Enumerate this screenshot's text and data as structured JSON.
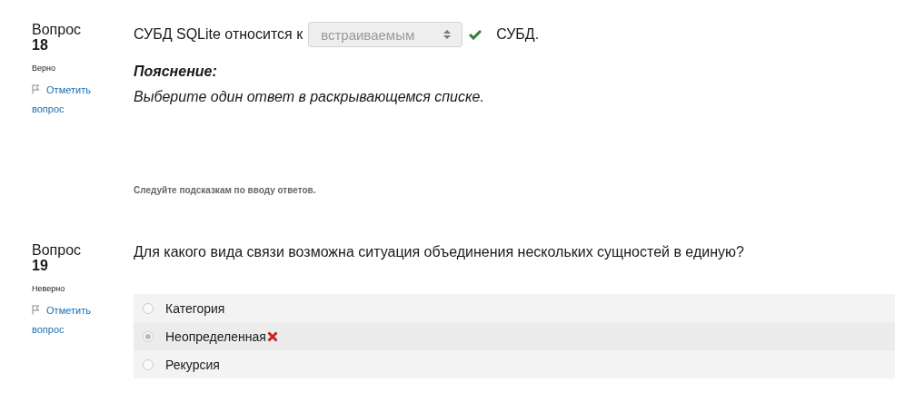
{
  "questions": [
    {
      "kind": "select",
      "label": "Вопрос",
      "number": "18",
      "status": "Верно",
      "flag_link": "Отметить вопрос",
      "text_before": "СУБД SQLite относится к",
      "select": {
        "value": "встраиваемым",
        "disabled": true,
        "correct": true
      },
      "text_after": "СУБД.",
      "explanation_title": "Пояснение:",
      "explanation": "Выберите один ответ в раскрывающемся списке.",
      "hint": "Следуйте подсказкам по вводу ответов."
    },
    {
      "kind": "choice",
      "label": "Вопрос",
      "number": "19",
      "status": "Неверно",
      "flag_link": "Отметить вопрос",
      "text": "Для какого вида связи возможна ситуация объединения нескольких сущностей в единую?",
      "options": [
        {
          "label": "Категория",
          "selected": false,
          "wrong": false
        },
        {
          "label": "Неопределенная",
          "selected": true,
          "wrong": true
        },
        {
          "label": "Рекурсия",
          "selected": false,
          "wrong": false
        }
      ]
    }
  ]
}
